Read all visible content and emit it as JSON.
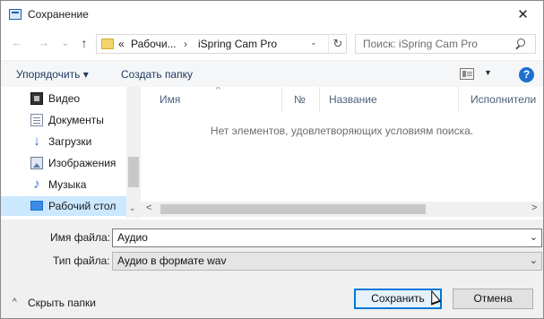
{
  "window": {
    "title": "Сохранение",
    "close_glyph": "✕"
  },
  "nav": {
    "back_glyph": "←",
    "forward_glyph": "→",
    "recent_glyph": "⌄",
    "up_glyph": "↑"
  },
  "address": {
    "overflow": "«",
    "crumb1": "Рабочи...",
    "separator": "›",
    "crumb2": "iSpring Cam Pro",
    "dropdown_glyph": "⌄",
    "refresh_glyph": "↻"
  },
  "search": {
    "placeholder": "Поиск: iSpring Cam Pro"
  },
  "toolbar": {
    "organize": "Упорядочить ▾",
    "new_folder": "Создать папку",
    "view_drop_glyph": "▼",
    "help_glyph": "?"
  },
  "sidebar": {
    "items": [
      {
        "label": "Видео",
        "icon": "video-icon"
      },
      {
        "label": "Документы",
        "icon": "documents-icon"
      },
      {
        "label": "Загрузки",
        "icon": "downloads-icon"
      },
      {
        "label": "Изображения",
        "icon": "pictures-icon"
      },
      {
        "label": "Музыка",
        "icon": "music-icon"
      },
      {
        "label": "Рабочий стол",
        "icon": "desktop-icon",
        "selected": true
      }
    ],
    "scroll_down_glyph": "⌄"
  },
  "filelist": {
    "columns": [
      "Имя",
      "№",
      "Название",
      "Исполнители"
    ],
    "sort_glyph": "^",
    "empty_message": "Нет элементов, удовлетворяющих условиям поиска.",
    "scroll_left_glyph": "<",
    "scroll_right_glyph": ">"
  },
  "form": {
    "filename_label": "Имя файла:",
    "filename_value": "Аудио",
    "filetype_label": "Тип файла:",
    "filetype_value": "Аудио в формате wav",
    "dropdown_glyph": "⌄"
  },
  "footer": {
    "hide_caret": "^",
    "hide_folders": "Скрыть папки",
    "save": "Сохранить",
    "cancel": "Отмена"
  },
  "colors": {
    "accent": "#0078d7",
    "selected_bg": "#cce8ff",
    "help_blue": "#1e6fd0"
  }
}
